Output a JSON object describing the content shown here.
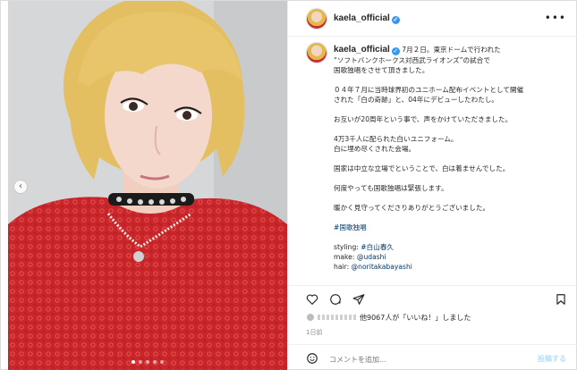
{
  "post": {
    "username": "kaela_official",
    "more_icon": "more-icon",
    "caption": {
      "paragraphs": [
        "7月２日。東京ドームで行われた\n“ソフトバンクホークス対西武ライオンズ”の試合で\n国歌独唱をさせて頂きました。",
        "０４年７月に当時球界初のユニホーム配布イベントとして開催\nされた「白の奇跡」と、04年にデビューしたわたし。",
        "お互いが20周年という事で、声をかけていただきました。",
        "4万3千人に配られた白いユニフォーム。\n白に埋め尽くされた会場。",
        "国家は中立な立場でということで、白は着ませんでした。",
        "何度やっても国歌独唱は緊張します。",
        "暖かく見守ってくださりありがとうございました。"
      ],
      "hashtag": "#国歌独唱",
      "credits": [
        {
          "label": "styling:",
          "value": "#白山春久"
        },
        {
          "label": "make:",
          "value": "@udashi"
        },
        {
          "label": "hair:",
          "value": "@noritakabayashi"
        }
      ]
    },
    "likes_text": "他9067人が「いいね！」しました",
    "time": "1日前",
    "comment_placeholder": "コメントを追加...",
    "post_label": "投稿する",
    "carousel": {
      "count": 5,
      "active": 0
    }
  },
  "colors": {
    "link": "#00376b",
    "verified": "#3897f0",
    "muted": "#8e8e8e",
    "dress": "#c8262a",
    "hair": "#e3bf62"
  }
}
